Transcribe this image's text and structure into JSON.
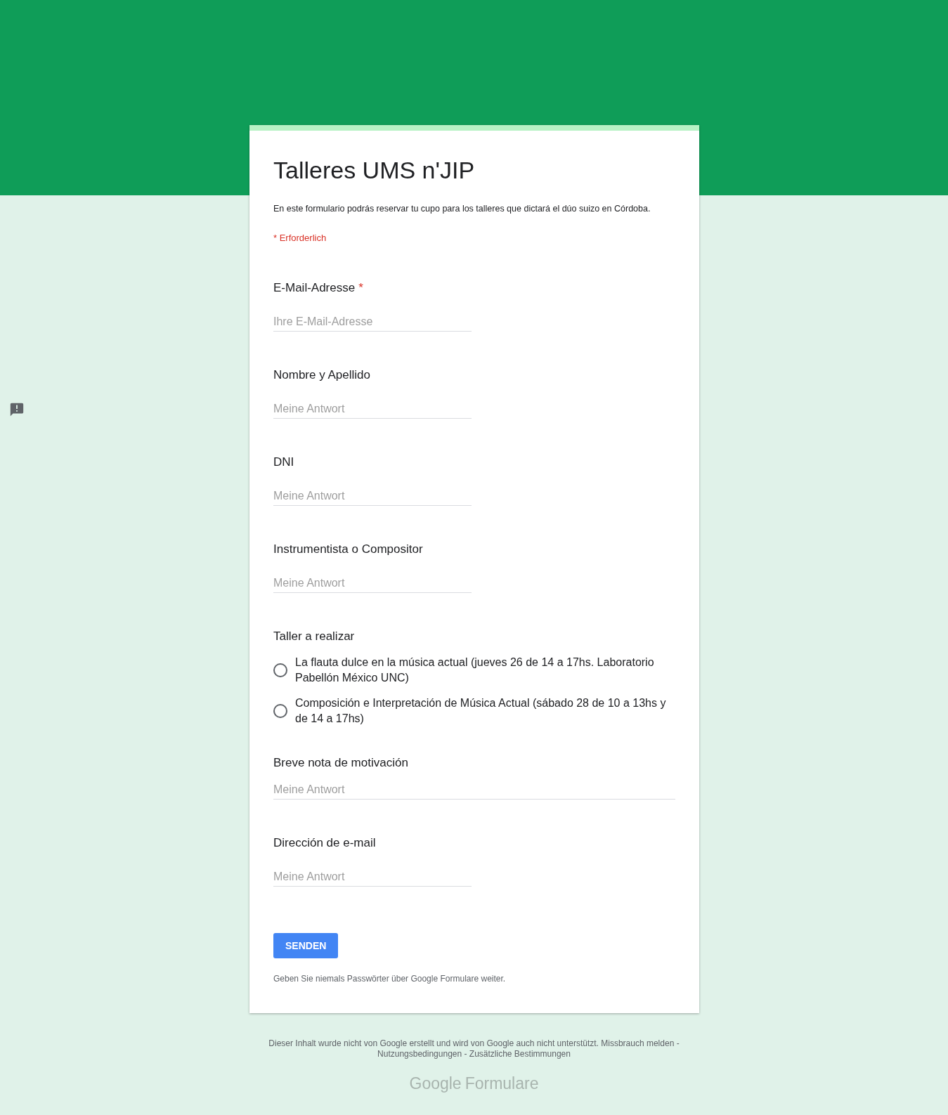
{
  "form": {
    "title": "Talleres UMS n'JIP",
    "description": "En este formulario podrás reservar tu cupo para los talleres que dictará el dúo suizo en Córdoba.",
    "required_note": "* Erforderlich",
    "required_mark": "*",
    "questions": [
      {
        "kind": "text",
        "label": "E-Mail-Adresse",
        "required": true,
        "placeholder": "Ihre E-Mail-Adresse"
      },
      {
        "kind": "text",
        "label": "Nombre y Apellido",
        "required": false,
        "placeholder": "Meine Antwort"
      },
      {
        "kind": "text",
        "label": "DNI",
        "required": false,
        "placeholder": "Meine Antwort"
      },
      {
        "kind": "text",
        "label": "Instrumentista o Compositor",
        "required": false,
        "placeholder": "Meine Antwort"
      },
      {
        "kind": "radio",
        "label": "Taller a realizar",
        "required": false,
        "options": [
          {
            "label": "La flauta dulce en la música actual (jueves 26 de 14 a 17hs. Laboratorio Pabellón México UNC)",
            "selected": false
          },
          {
            "label": "Composición e Interpretación de Música Actual (sábado 28 de 10 a 13hs y de 14 a 17hs)",
            "selected": false
          }
        ]
      },
      {
        "kind": "paragraph",
        "label": "Breve nota de motivación",
        "required": false,
        "placeholder": "Meine Antwort"
      },
      {
        "kind": "text",
        "label": "Dirección de e-mail",
        "required": false,
        "placeholder": "Meine Antwort"
      }
    ],
    "submit": "SENDEN",
    "password_warning": "Geben Sie niemals Passwörter über Google Formulare weiter."
  },
  "footer": {
    "notice": "Dieser Inhalt wurde nicht von Google erstellt und wird von Google auch nicht unterstützt.",
    "links": [
      "Missbrauch melden",
      "Nutzungsbedingungen",
      "Zusätzliche Bestimmungen"
    ],
    "separator": "-",
    "logo_brand": "Google",
    "logo_product": "Formulare"
  }
}
